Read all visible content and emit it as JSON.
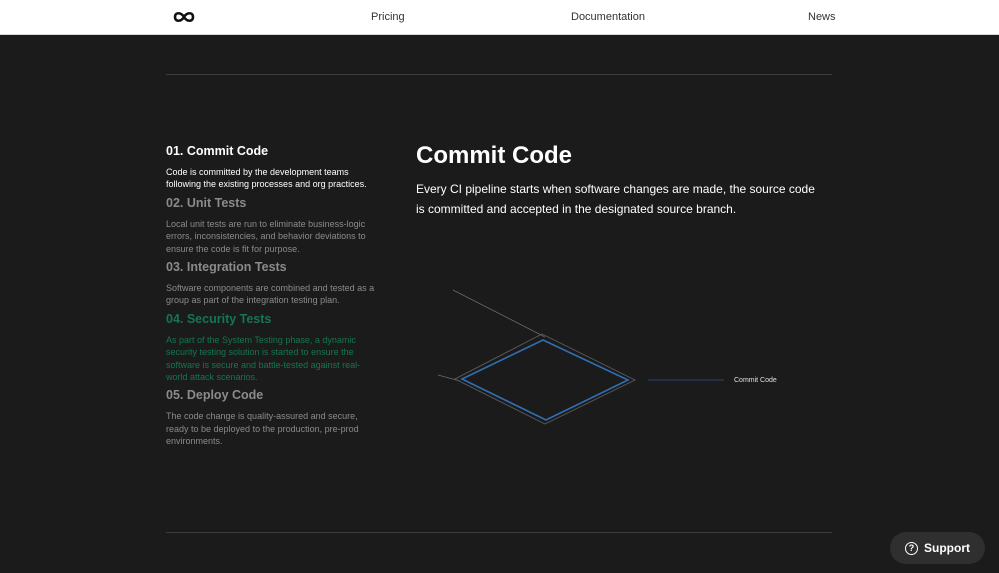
{
  "nav": {
    "logo_icon": "infinity-logo",
    "links": [
      "Pricing",
      "Documentation",
      "News"
    ]
  },
  "steps": [
    {
      "title": "01. Commit Code",
      "body": "Code is committed by the development teams following the existing processes and org practices.",
      "state": "active"
    },
    {
      "title": "02. Unit Tests",
      "body": "Local unit tests are run to eliminate business-logic errors, inconsistencies, and behavior deviations to ensure the code is fit for purpose.",
      "state": "dim"
    },
    {
      "title": "03. Integration Tests",
      "body": "Software components are combined and tested as a group as part of the integration testing plan.",
      "state": "dim"
    },
    {
      "title": "04. Security Tests",
      "body": "As part of the System Testing phase, a dynamic security testing solution is started to ensure the software is secure and battle-tested against real-world attack scenarios.",
      "state": "highlight"
    },
    {
      "title": "05. Deploy Code",
      "body": "The code change is quality-assured and secure, ready to be deployed to the production, pre-prod environments.",
      "state": "dim"
    }
  ],
  "detail": {
    "title": "Commit Code",
    "description": "Every CI pipeline starts when software changes are made, the source code is committed and accepted in the designated source branch."
  },
  "diagram": {
    "label": "Commit Code",
    "accent": "#2f6fb8"
  },
  "support": {
    "label": "Support",
    "icon": "help-circle-icon"
  },
  "colors": {
    "background": "#1b1b1b",
    "highlight_green": "#15764f",
    "muted_text": "#8b8b8b"
  }
}
